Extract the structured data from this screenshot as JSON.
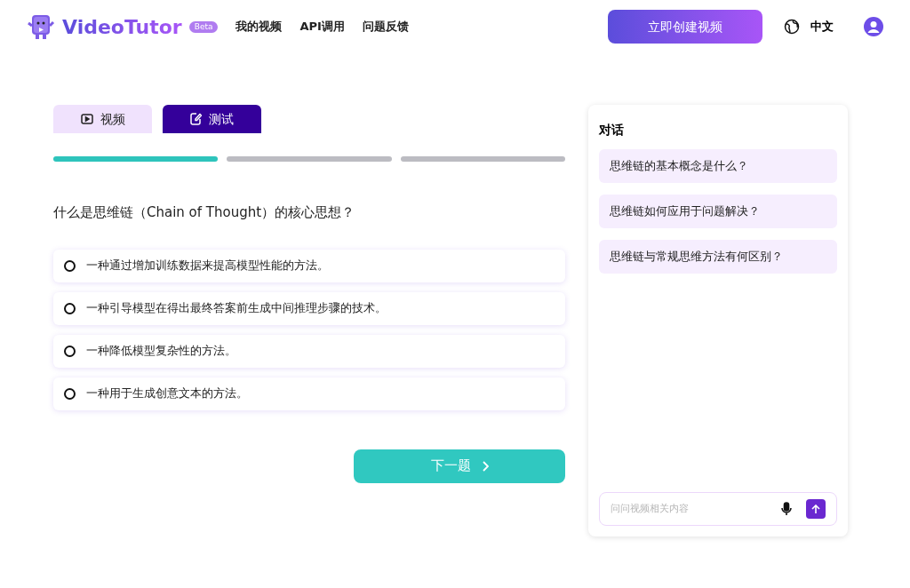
{
  "header": {
    "logo": "VideoTutor",
    "badge": "Beta",
    "nav": [
      "我的视频",
      "API调用",
      "问题反馈"
    ],
    "create_button": "立即创建视频",
    "language": "中文"
  },
  "tabs": [
    {
      "label": "视频",
      "kind": "video",
      "selected": false
    },
    {
      "label": "测试",
      "kind": "quiz",
      "selected": true
    }
  ],
  "progress": [
    {
      "completed": true
    },
    {
      "completed": false
    },
    {
      "completed": false
    }
  ],
  "question": "什么是思维链（Chain of Thought）的核心思想？",
  "options": [
    {
      "label": "一种通过增加训练数据来提高模型性能的方法。",
      "selected": false
    },
    {
      "label": "一种引导模型在得出最终答案前生成中间推理步骤的技术。",
      "selected": false
    },
    {
      "label": "一种降低模型复杂性的方法。",
      "selected": false
    },
    {
      "label": "一种用于生成创意文本的方法。",
      "selected": false
    }
  ],
  "next_button": "下一题",
  "chat": {
    "title": "对话",
    "suggestions": [
      "思维链的基本概念是什么？",
      "思维链如何应用于问题解决？",
      "思维链与常规思维方法有何区别？"
    ],
    "placeholder": "问问视频相关内容"
  }
}
